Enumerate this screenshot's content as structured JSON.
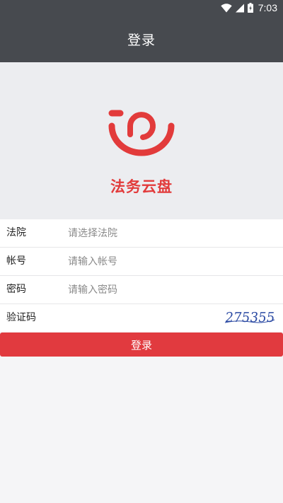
{
  "status_bar": {
    "time": "7:03",
    "icons": [
      "wifi-icon",
      "cellular-signal-icon",
      "battery-icon"
    ]
  },
  "app_bar": {
    "title": "登录"
  },
  "brand": {
    "name": "法务云盘",
    "logo_icon": "cloud-disk-logo-icon",
    "color": "#e23b3b"
  },
  "form": {
    "court": {
      "label": "法院",
      "placeholder": "请选择法院",
      "value": ""
    },
    "account": {
      "label": "帐号",
      "placeholder": "请输入帐号",
      "value": ""
    },
    "password": {
      "label": "密码",
      "placeholder": "请输入密码",
      "value": ""
    },
    "captcha": {
      "label": "验证码",
      "value": "",
      "image_text": "275355"
    }
  },
  "actions": {
    "login_label": "登录"
  },
  "colors": {
    "header": "#474a4f",
    "hero_background": "#ecedf0",
    "accent": "#e13a3f",
    "page_background": "#f5f5f7"
  }
}
